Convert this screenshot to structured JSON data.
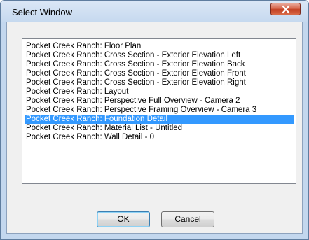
{
  "window": {
    "title": "Select Window",
    "close_icon": "close-icon",
    "close_color": "#c23f22"
  },
  "list": {
    "items": [
      "Pocket Creek Ranch: Floor Plan",
      "Pocket Creek Ranch: Cross Section - Exterior Elevation Left",
      "Pocket Creek Ranch: Cross Section - Exterior Elevation Back",
      "Pocket Creek Ranch: Cross Section - Exterior Elevation Front",
      "Pocket Creek Ranch: Cross Section - Exterior Elevation Right",
      "Pocket Creek Ranch: Layout",
      "Pocket Creek Ranch: Perspective Full Overview - Camera 2",
      "Pocket Creek Ranch: Perspective Framing Overview - Camera 3",
      "Pocket Creek Ranch: Foundation Detail",
      "Pocket Creek Ranch: Material List - Untitled",
      "Pocket Creek Ranch: Wall Detail - 0"
    ],
    "selected_index": 8,
    "selection_color": "#3399ff"
  },
  "buttons": {
    "ok_label": "OK",
    "cancel_label": "Cancel"
  }
}
